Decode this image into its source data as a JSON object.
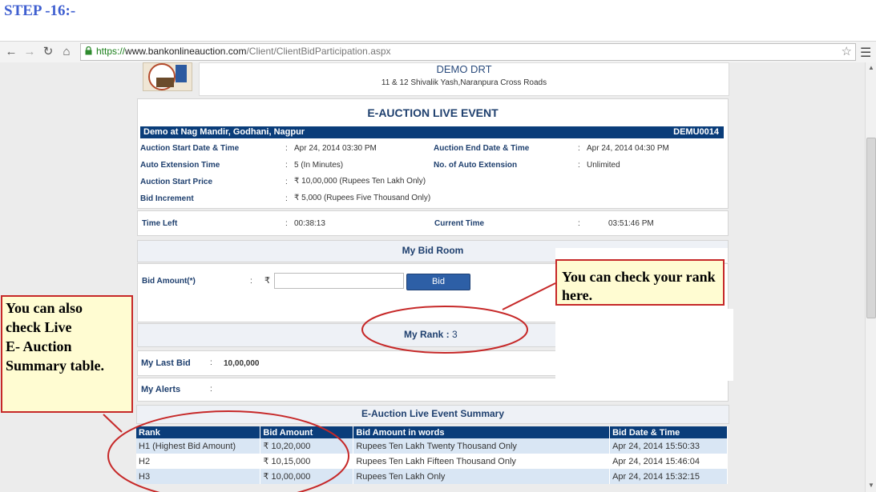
{
  "step": {
    "heading": "STEP -16:-"
  },
  "browser": {
    "url_scheme": "https://",
    "url_host": "www.bankonlineauction.com",
    "url_path": "/Client/ClientBidParticipation.aspx"
  },
  "header": {
    "org_name": "DEMO DRT",
    "org_address": "11 & 12 Shivalik Yash,Naranpura Cross Roads"
  },
  "event": {
    "title": "E-AUCTION LIVE EVENT",
    "location": "Demo at Nag Mandir, Godhani, Nagpur",
    "code": "DEMU0014",
    "fields": {
      "start_label": "Auction Start Date & Time",
      "start_value": "Apr 24, 2014   03:30 PM",
      "end_label": "Auction End Date & Time",
      "end_value": "Apr 24, 2014   04:30 PM",
      "ext_time_label": "Auto Extension Time",
      "ext_time_value": "5 (In Minutes)",
      "ext_count_label": "No. of Auto Extension",
      "ext_count_value": "Unlimited",
      "start_price_label": "Auction Start Price",
      "start_price_value": "10,00,000 (Rupees Ten Lakh Only)",
      "increment_label": "Bid Increment",
      "increment_value": "5,000 (Rupees Five Thousand Only)"
    },
    "time_left_label": "Time Left",
    "time_left_value": "00:38:13",
    "current_time_label": "Current Time",
    "current_time_value": "03:51:46 PM"
  },
  "bid_room": {
    "title": "My Bid Room",
    "amount_label": "Bid Amount(*)",
    "bid_button": "Bid",
    "rank_label": "My Rank : ",
    "rank_value": "3",
    "last_bid_label": "My Last Bid",
    "last_bid_value": "10,00,000",
    "alerts_label": "My Alerts"
  },
  "summary": {
    "title": "E-Auction Live Event Summary",
    "headers": [
      "Rank",
      "Bid Amount",
      "Bid Amount in words",
      "Bid Date & Time"
    ],
    "rows": [
      {
        "rank": "H1 (Highest Bid Amount)",
        "amount": "10,20,000",
        "words": "Rupees Ten Lakh Twenty Thousand Only",
        "datetime": "Apr 24, 2014 15:50:33"
      },
      {
        "rank": "H2",
        "amount": "10,15,000",
        "words": "Rupees Ten Lakh Fifteen Thousand Only",
        "datetime": "Apr 24, 2014 15:46:04"
      },
      {
        "rank": "H3",
        "amount": "10,00,000",
        "words": "Rupees Ten Lakh Only",
        "datetime": "Apr 24, 2014 15:32:15"
      }
    ]
  },
  "annotations": {
    "rank_note": "You can check your rank here.",
    "summary_note_lines": [
      "You can also",
      "check Live",
      "E- Auction",
      "Summary  table."
    ]
  },
  "colors": {
    "accent_blue": "#0a3d7a",
    "annotation_red": "#c62828",
    "callout_bg": "#fffcd2"
  }
}
